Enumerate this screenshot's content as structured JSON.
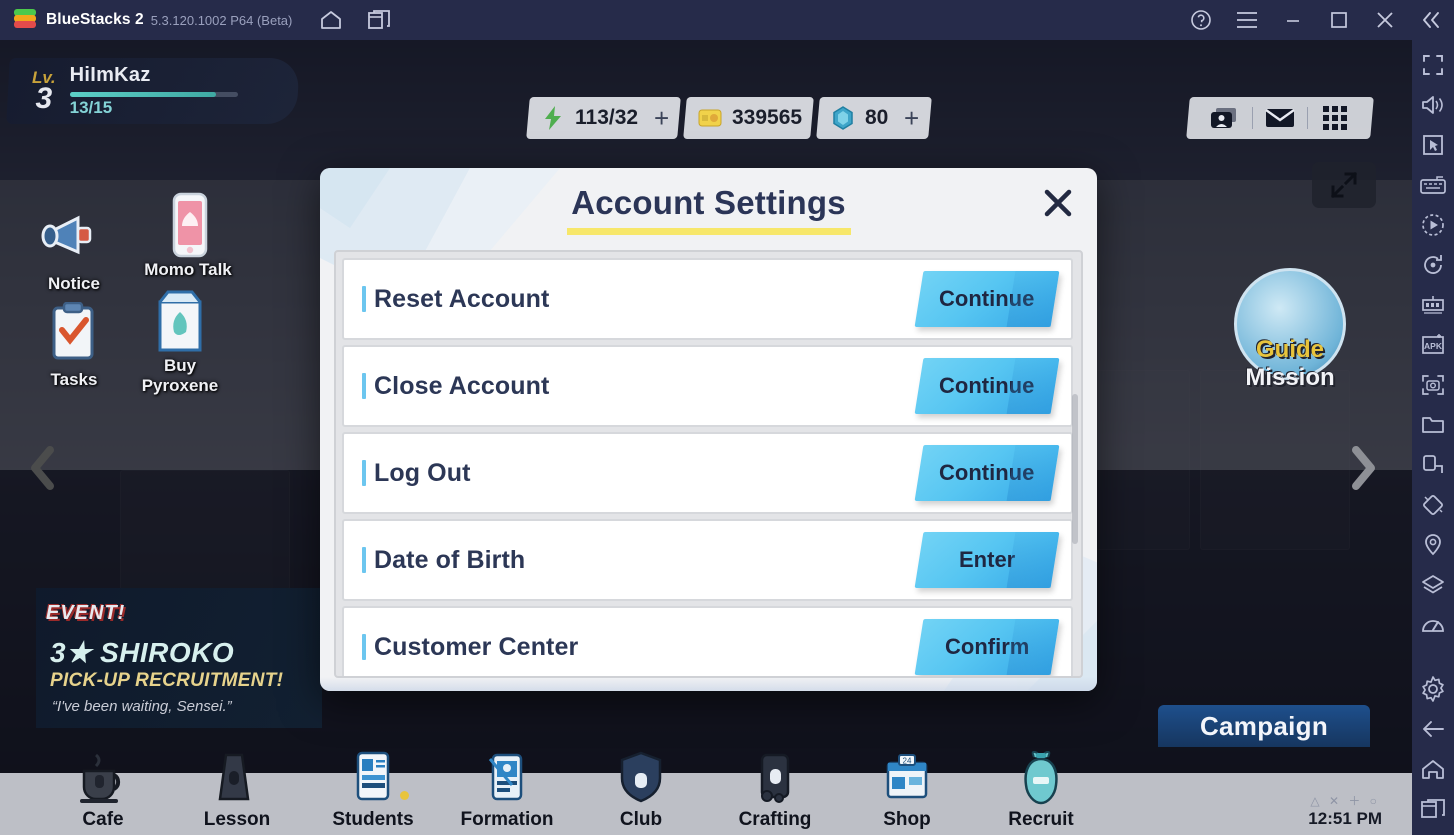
{
  "titlebar": {
    "app_name": "BlueStacks 2",
    "version": "5.3.120.1002 P64 (Beta)",
    "icons": {
      "home": "home-icon",
      "multi_instance": "multi-instance-icon",
      "help": "help-icon",
      "menu": "hamburger-menu-icon",
      "minimize": "minimize-icon",
      "maximize": "maximize-icon",
      "close": "close-icon",
      "collapse": "collapse-sidebar-icon"
    }
  },
  "sidebar": {
    "items": [
      {
        "name": "fullscreen-icon",
        "label": "Fullscreen"
      },
      {
        "name": "volume-icon",
        "label": "Volume"
      },
      {
        "name": "cursor-icon",
        "label": "Game controls"
      },
      {
        "name": "keyboard-icon",
        "label": "Keyboard controls"
      },
      {
        "name": "macro-play-icon",
        "label": "Macro recorder"
      },
      {
        "name": "rotate-icon",
        "label": "Rotate"
      },
      {
        "name": "eco-mode-icon",
        "label": "Eco mode"
      },
      {
        "name": "install-apk-icon",
        "label": "Install APK"
      },
      {
        "name": "screenshot-icon",
        "label": "Screenshot"
      },
      {
        "name": "media-folder-icon",
        "label": "Media manager"
      },
      {
        "name": "shake-icon",
        "label": "Shake"
      },
      {
        "name": "tilt-icon",
        "label": "Tilt"
      },
      {
        "name": "location-icon",
        "label": "Location"
      },
      {
        "name": "multi-layer-icon",
        "label": "Layers"
      },
      {
        "name": "performance-icon",
        "label": "Performance"
      },
      {
        "name": "settings-gear-icon",
        "label": "Settings"
      },
      {
        "name": "back-arrow-icon",
        "label": "Back"
      },
      {
        "name": "home-nav-icon",
        "label": "Home"
      },
      {
        "name": "recents-icon",
        "label": "Recent apps"
      }
    ]
  },
  "hud": {
    "player": {
      "level_label": "Lv.",
      "level_value": "3",
      "name": "HiImKaz",
      "xp_text": "13/15",
      "xp_percent": 87
    },
    "currencies": [
      {
        "icon": "ap-energy-icon",
        "value": "113/32",
        "has_plus": true
      },
      {
        "icon": "credits-icon",
        "value": "339565",
        "has_plus": false
      },
      {
        "icon": "pyroxene-icon",
        "value": "80",
        "has_plus": true
      }
    ],
    "right_buttons": [
      {
        "name": "profile-card-icon"
      },
      {
        "name": "mail-icon"
      },
      {
        "name": "app-grid-icon"
      }
    ],
    "expand_button": "expand-screen-icon"
  },
  "left_menu": [
    {
      "label": "Notice",
      "icon": "megaphone-icon"
    },
    {
      "label": "Momo Talk",
      "icon": "phone-chat-icon"
    },
    {
      "label": "Tasks",
      "icon": "clipboard-check-icon"
    },
    {
      "label": "Buy Pyroxene",
      "icon": "shopping-bag-icon"
    }
  ],
  "event_banner": {
    "tag": "EVENT!",
    "title": "3★ SHIROKO",
    "subtitle": "PICK-UP RECRUITMENT!",
    "quote": "“I've been waiting, Sensei.”"
  },
  "guide_mission": {
    "line1": "Guide",
    "line2": "Mission"
  },
  "nav_arrows": {
    "left": "chevron-left-icon",
    "right": "chevron-right-icon"
  },
  "campaign_tab": {
    "label": "Campaign"
  },
  "bottom_nav": {
    "items": [
      {
        "label": "Cafe",
        "icon": "cafe-cup-icon",
        "locked": true,
        "badge": false
      },
      {
        "label": "Lesson",
        "icon": "lesson-icon",
        "locked": true,
        "badge": false
      },
      {
        "label": "Students",
        "icon": "students-card-icon",
        "locked": false,
        "badge": true
      },
      {
        "label": "Formation",
        "icon": "formation-icon",
        "locked": false,
        "badge": false
      },
      {
        "label": "Club",
        "icon": "club-shield-icon",
        "locked": true,
        "badge": false
      },
      {
        "label": "Crafting",
        "icon": "crafting-icon",
        "locked": true,
        "badge": false
      },
      {
        "label": "Shop",
        "icon": "shop-icon",
        "locked": false,
        "badge": false
      },
      {
        "label": "Recruit",
        "icon": "recruit-icon",
        "locked": false,
        "badge": false
      }
    ],
    "clock": {
      "pad_glyphs": "△ ✕ ＋ ○",
      "time": "12:51 PM"
    }
  },
  "modal": {
    "title": "Account Settings",
    "close_icon": "close-icon",
    "rows": [
      {
        "label": "Reset Account",
        "button": "Continue"
      },
      {
        "label": "Close Account",
        "button": "Continue"
      },
      {
        "label": "Log Out",
        "button": "Continue"
      },
      {
        "label": "Date of Birth",
        "button": "Enter"
      },
      {
        "label": "Customer Center",
        "button": "Confirm"
      }
    ]
  },
  "colors": {
    "titlebar_bg": "#262b4a",
    "modal_bg": "#f1f2f4",
    "title_text": "#2b3557",
    "title_underline": "#f7e76a",
    "button_gradient_start": "#72d3f5",
    "button_gradient_end": "#36a9e8",
    "row_accent": "#6cc6ef",
    "level_gold": "#c8a23a",
    "xp_teal": "#84d3d6"
  }
}
